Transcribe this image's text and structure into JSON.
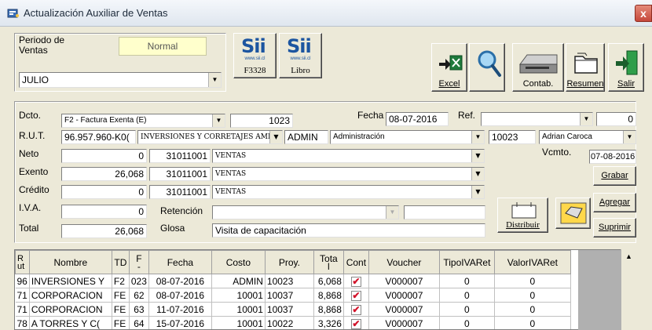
{
  "window": {
    "title": "Actualización Auxiliar de Ventas",
    "close": "x"
  },
  "header": {
    "periodo_label": "Periodo de\nVentas",
    "mode": "Normal",
    "month": "JULIO",
    "sii_buttons": [
      {
        "logo": "Sii",
        "site": "www.sii.cl",
        "caption": "F3328"
      },
      {
        "logo": "Sii",
        "site": "www.sii.cl",
        "caption": "Libro"
      }
    ],
    "tools": [
      {
        "caption": "Excel"
      },
      {
        "caption": ""
      },
      {
        "caption": "Contab."
      },
      {
        "caption": "Resumen"
      },
      {
        "caption": "Salir"
      }
    ]
  },
  "form": {
    "dcto_label": "Dcto.",
    "dcto_value": "F2 - Factura Exenta (E)",
    "dcto_number": "1023",
    "fecha_label": "Fecha",
    "fecha_value": "08-07-2016",
    "ref_label": "Ref.",
    "ref_value": "",
    "ref_number": "0",
    "rut_label": "R.U.T.",
    "rut_value": "96.957.960-K0(",
    "rut_name": "INVERSIONES Y CORRETAJES AMI",
    "user": "ADMIN",
    "area": "Administración",
    "code": "10023",
    "person": "Adrian Caroca",
    "neto_label": "Neto",
    "neto_value": "0",
    "neto_cuenta": "31011001",
    "neto_desc": "VENTAS",
    "exento_label": "Exento",
    "exento_value": "26,068",
    "exento_cuenta": "31011001",
    "exento_desc": "VENTAS",
    "credito_label": "Crédito",
    "credito_value": "0",
    "credito_cuenta": "31011001",
    "credito_desc": "VENTAS",
    "iva_label": "I.V.A.",
    "iva_value": "0",
    "retencion_label": "Retención",
    "retencion_value": "",
    "total_label": "Total",
    "total_value": "26,068",
    "glosa_label": "Glosa",
    "glosa_value": "Visita de capacitación",
    "vcmto_label": "Vcmto.",
    "vcmto_value": "07-08-2016"
  },
  "actions": {
    "grabar": "Grabar",
    "agregar": "Agregar",
    "suprimir": "Suprimir",
    "distribuir": "Distribuir"
  },
  "table": {
    "headers": [
      "R\nut",
      "Nombre",
      "TD",
      "F\n-",
      "Fecha",
      "Costo",
      "Proy.",
      "Tota\nl",
      "Cont",
      "Voucher",
      "TipoIVARet",
      "ValorIVARet"
    ],
    "rows": [
      [
        "96",
        "INVERSIONES Y",
        "F2",
        "023",
        "08-07-2016",
        "ADMIN",
        "10023",
        "6,068",
        "✔",
        "V000007",
        "0",
        "0"
      ],
      [
        "71",
        "CORPORACION",
        "FE",
        "62",
        "08-07-2016",
        "10001",
        "10037",
        "8,868",
        "✔",
        "V000007",
        "0",
        "0"
      ],
      [
        "71",
        "CORPORACION",
        "FE",
        "63",
        "11-07-2016",
        "10001",
        "10037",
        "8,868",
        "✔",
        "V000007",
        "0",
        "0"
      ],
      [
        "78",
        "A TORRES Y C(",
        "FE",
        "64",
        "15-07-2016",
        "10001",
        "10022",
        "3,326",
        "✔",
        "V000007",
        "0",
        "0"
      ]
    ]
  }
}
